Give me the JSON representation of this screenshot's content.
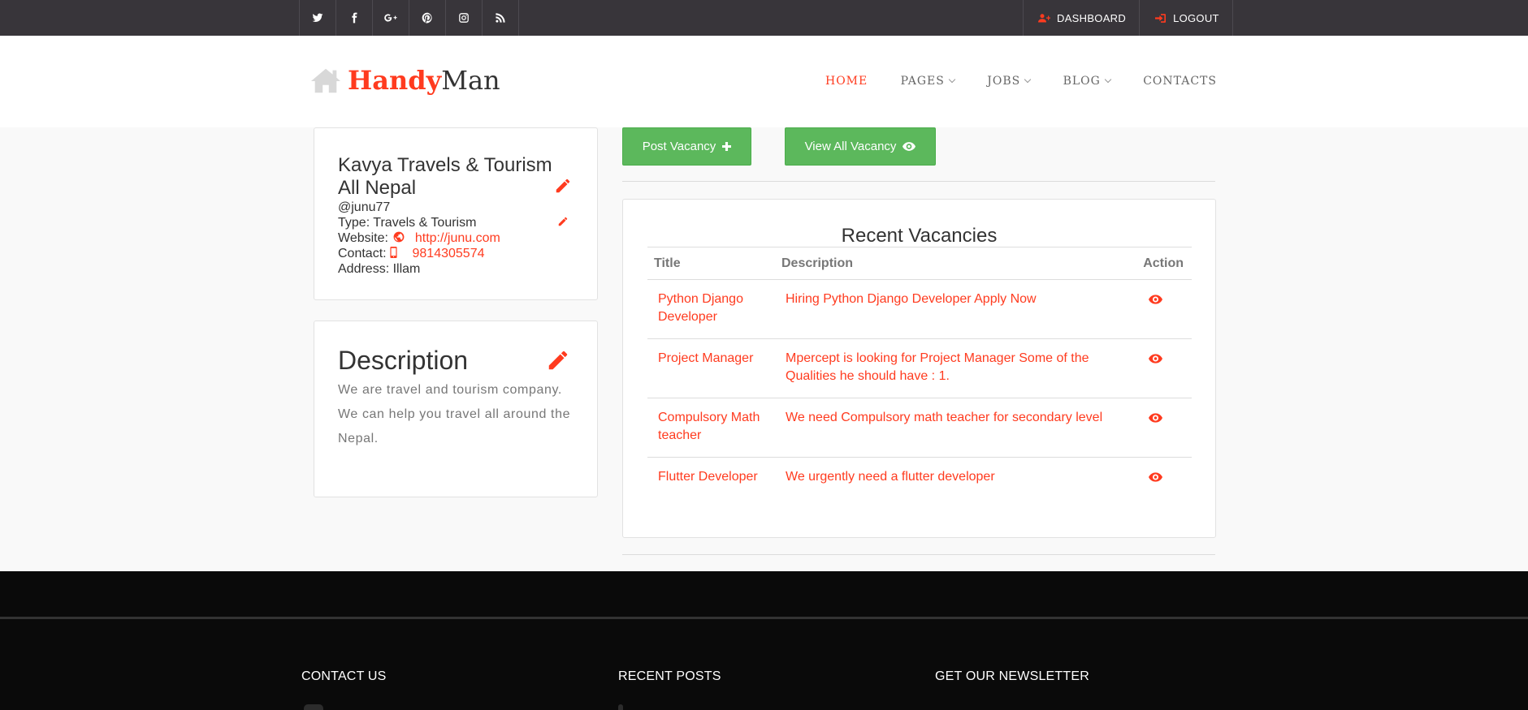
{
  "topbar": {
    "social": [
      {
        "name": "twitter-icon"
      },
      {
        "name": "facebook-icon"
      },
      {
        "name": "google-plus-icon"
      },
      {
        "name": "pinterest-icon"
      },
      {
        "name": "instagram-icon"
      },
      {
        "name": "rss-icon"
      }
    ],
    "dashboard_label": "DASHBOARD",
    "logout_label": "LOGOUT"
  },
  "header": {
    "logo_part1": "Handy",
    "logo_part2": "Man",
    "nav": {
      "home": "HOME",
      "pages": "PAGES",
      "jobs": "JOBS",
      "blog": "BLOG",
      "contacts": "CONTACTS"
    }
  },
  "profile": {
    "company_name": "Kavya Travels & Tourism All Nepal",
    "username": "@junu77",
    "type_label": "Type:",
    "type_value": "Travels & Tourism",
    "website_label": "Website:",
    "website_value": "http://junu.com",
    "contact_label": "Contact:",
    "contact_value": "9814305574",
    "address_label": "Address:",
    "address_value": "Illam"
  },
  "description": {
    "title": "Description",
    "text": "We are travel and tourism company. We can help you travel all around the Nepal."
  },
  "buttons": {
    "post_vacancy": "Post Vacancy",
    "view_all_vacancy": "View All Vacancy"
  },
  "vacancies": {
    "title": "Recent Vacancies",
    "columns": {
      "title": "Title",
      "description": "Description",
      "action": "Action"
    },
    "rows": [
      {
        "title": "Python Django Developer",
        "description": "Hiring Python Django Developer Apply Now"
      },
      {
        "title": "Project Manager",
        "description": "Mpercept is looking for Project Manager Some of the Qualities he should have : 1."
      },
      {
        "title": "Compulsory Math teacher",
        "description": "We need Compulsory math teacher for secondary level"
      },
      {
        "title": "Flutter Developer",
        "description": "We urgently need a flutter developer"
      }
    ]
  },
  "footer": {
    "contact_us": "CONTACT US",
    "recent_posts": "RECENT POSTS",
    "newsletter": "GET OUR NEWSLETTER"
  },
  "colors": {
    "accent": "#ff3b1f",
    "topbar": "#38353a",
    "button_green": "#5cb85c",
    "footer": "#0a0a0a"
  }
}
